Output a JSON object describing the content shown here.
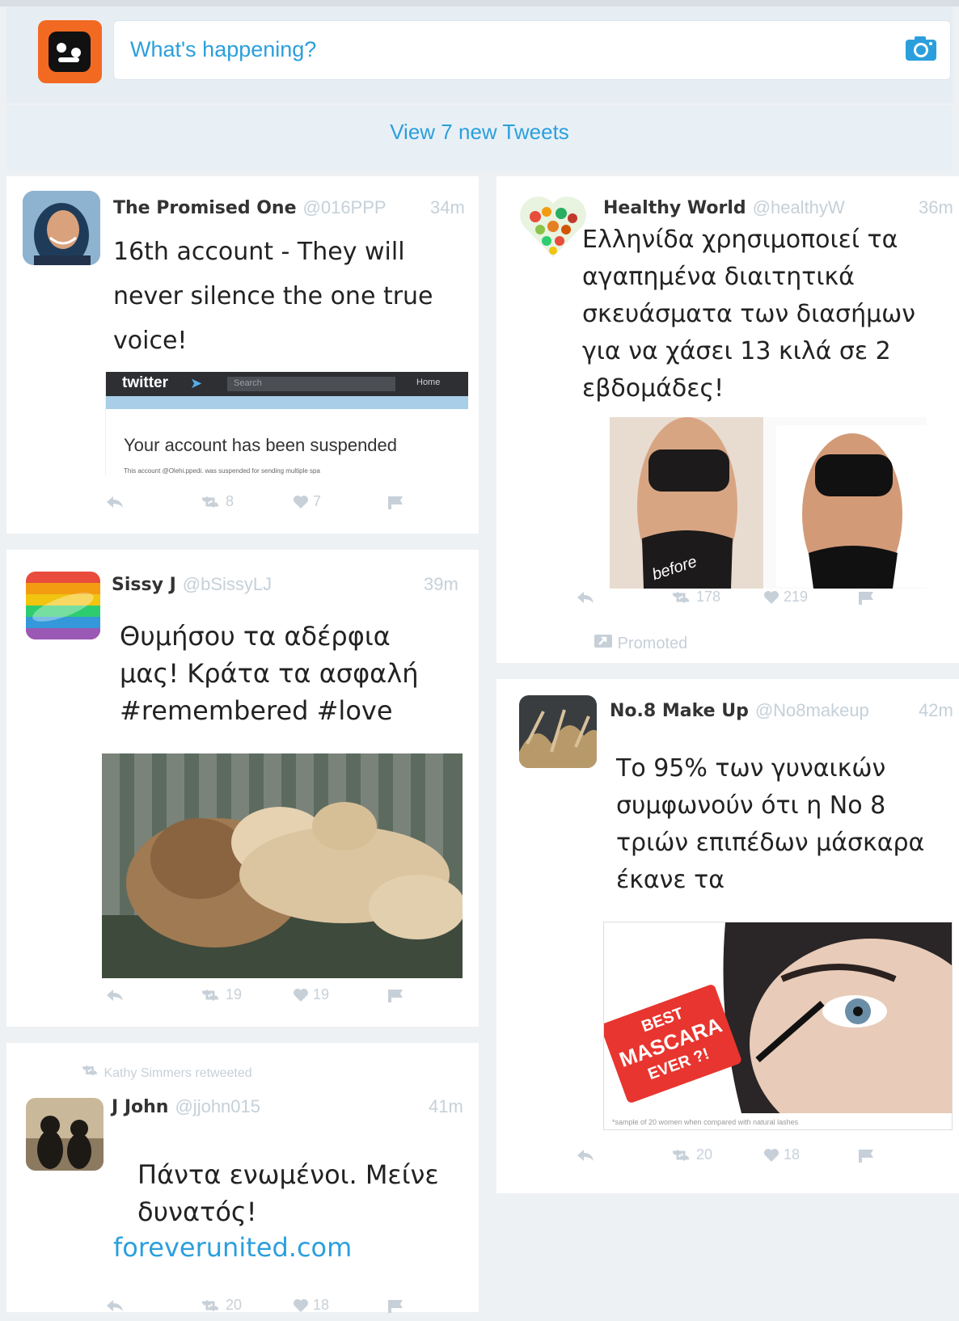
{
  "compose": {
    "placeholder": "What's happening?",
    "camera_icon": "camera-icon"
  },
  "banner": {
    "label": "View 7 new Tweets"
  },
  "tweets": [
    {
      "name": "The Promised One",
      "handle": "@016PPP",
      "time": "34m",
      "text_lines": [
        "16th account - They will",
        "never silence the one true",
        "voice!"
      ],
      "embed": {
        "brand": "twitter",
        "search": "Search",
        "nav": "Home",
        "message": "Your account has been suspended",
        "subtext": "This account @Olehi.ppedi. was suspended for sending multiple spa"
      },
      "actions": {
        "retweets": "8",
        "likes": "7"
      }
    },
    {
      "name": "Sissy J",
      "handle": "@bSissyLJ",
      "time": "39m",
      "text_lines": [
        "Θυμήσου τα αδέρφια",
        "μας! Κράτα τα ασφαλή",
        "#remembered #love"
      ],
      "actions": {
        "retweets": "19",
        "likes": "19"
      }
    },
    {
      "retweeted_by": "Kathy Simmers retweeted",
      "name": "J John",
      "handle": "@jjohn015",
      "time": "41m",
      "text_lines": [
        "Πάντα ενωμένοι. Μείνε",
        "δυνατός!"
      ],
      "link": "foreverunited.com",
      "actions": {
        "retweets": "20",
        "likes": "18"
      }
    },
    {
      "name": "Healthy World",
      "handle": "@healthyW",
      "time": "36m",
      "text_lines": [
        "Ελληνίδα χρησιμοποιεί τα",
        "αγαπημένα διαιτητικά",
        "σκευάσματα των διασήμων",
        "για να χάσει 13 κιλά σε 2",
        "εβδομάδες!"
      ],
      "image_caption": "before",
      "actions": {
        "retweets": "178",
        "likes": "219"
      },
      "promoted": "Promoted"
    },
    {
      "name": "No.8 Make Up",
      "handle": "@No8makeup",
      "time": "42m",
      "text_lines": [
        "Το 95% των γυναικών",
        "συμφωνούν ότι η No 8",
        "τριών επιπέδων μάσκαρα",
        "έκανε τα"
      ],
      "ad": {
        "badge": [
          "BEST",
          "MASCARA",
          "EVER ?!"
        ],
        "footnote": "*sample of 20 women when compared with natural lashes"
      },
      "actions": {
        "retweets": "20",
        "likes": "18"
      }
    }
  ]
}
